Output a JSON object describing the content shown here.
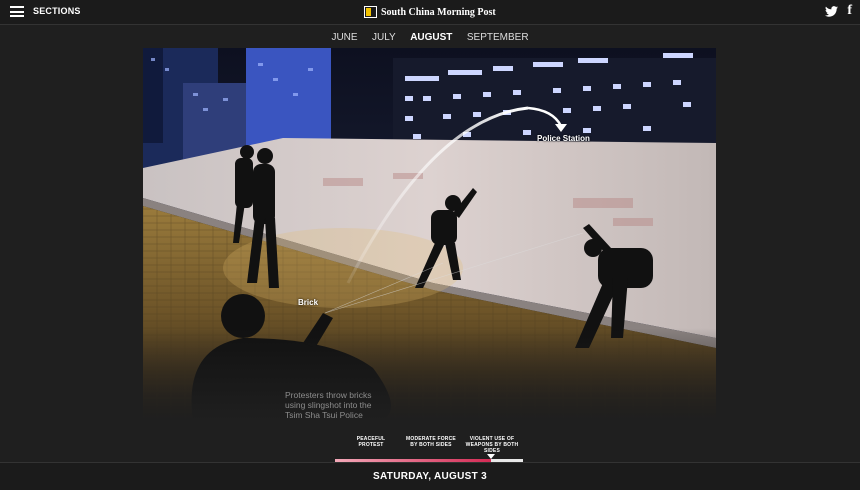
{
  "header": {
    "menu_label": "SECTIONS",
    "brand": "South China Morning Post",
    "icons": [
      "hamburger-icon",
      "brand-logo-icon",
      "twitter-icon",
      "facebook-icon"
    ]
  },
  "months": {
    "items": [
      {
        "label": "JUNE"
      },
      {
        "label": "JULY"
      },
      {
        "label": "AUGUST",
        "active": true
      },
      {
        "label": "SEPTEMBER"
      }
    ]
  },
  "photo": {
    "labels": {
      "police_station": "Police Station",
      "brick": "Brick"
    },
    "caption": "Protesters throw bricks using slingshot into the Tsim Sha Tsui Police"
  },
  "timeline": {
    "stages": {
      "peaceful": "PEACEFUL PROTEST",
      "moderate": "MODERATE FORCE BY BOTH SIDES",
      "violent": "VIOLENT USE OF WEAPONS BY BOTH SIDES"
    },
    "progress": 0.83,
    "colors": {
      "start": "#f3a8b8",
      "end": "#d42b55"
    }
  },
  "date": "SATURDAY, AUGUST 3"
}
